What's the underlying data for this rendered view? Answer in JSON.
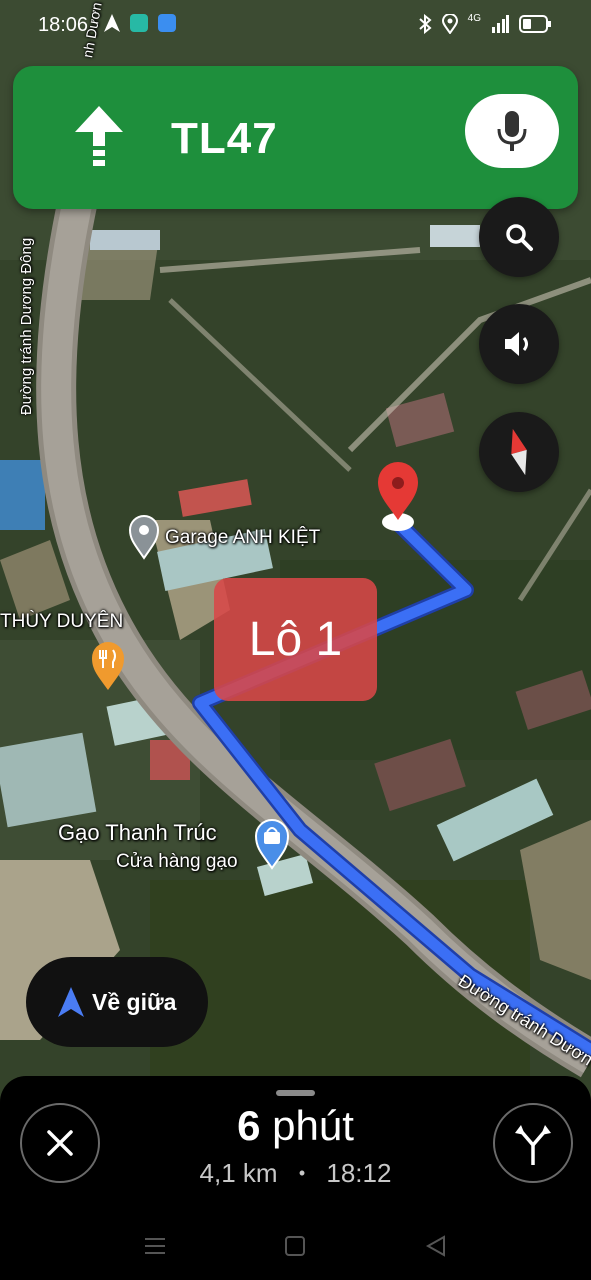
{
  "status_bar": {
    "time": "18:06",
    "network": "4G"
  },
  "navigation": {
    "street": "TL47",
    "direction_icon": "arrow-straight-icon"
  },
  "map": {
    "road_label_vertical": "Đường tránh Dương Đông",
    "road_label_bottom": "Đường tránh Dươn",
    "road_label_top": "nh Dươn",
    "poi_garage": "Garage ANH KIỆT",
    "poi_restaurant": "THÙY DUYÊN",
    "poi_rice_store_name": "Gạo Thanh Trúc",
    "poi_rice_store_type": "Cửa hàng gạo",
    "lot_label": "Lô 1",
    "route_color": "#3b6ff5"
  },
  "controls": {
    "recenter_label": "Về giữa"
  },
  "trip": {
    "duration_value": "6",
    "duration_unit": "phút",
    "distance": "4,1 km",
    "separator": "•",
    "arrival_time": "18:12"
  },
  "colors": {
    "banner": "#1e8f3c",
    "pin": "#e53935",
    "lot_box": "#d84848"
  }
}
